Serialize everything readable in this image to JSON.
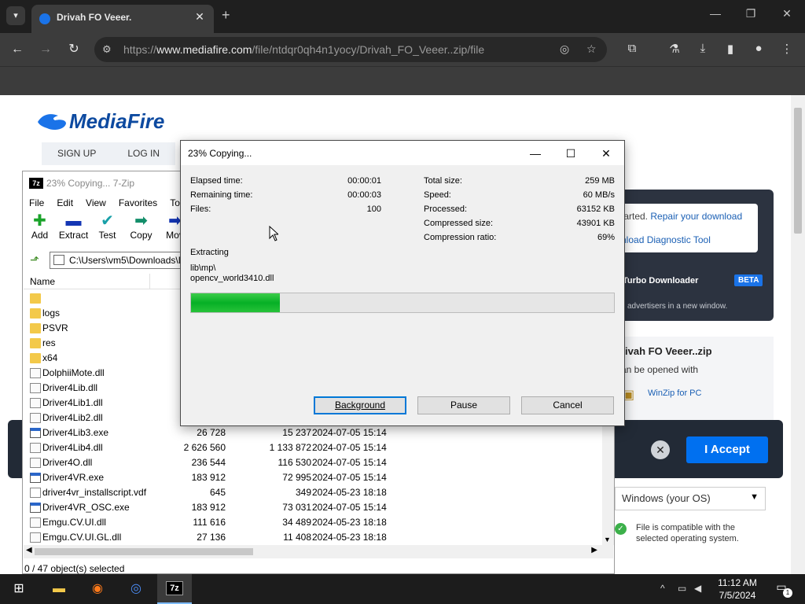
{
  "browser": {
    "tab_title": "Drivah FO Veeer.",
    "url_prefix": "https://",
    "url_host": "www.mediafire.com",
    "url_path": "/file/ntdqr0qh4n1yocy/Drivah_FO_Veeer..zip/file",
    "new_tab_label": "+"
  },
  "mediafire": {
    "logo_text": "MediaFire",
    "nav": [
      "SIGN UP",
      "LOG IN"
    ],
    "panel_line1_prefix": "tarted.",
    "panel_link1": "Repair your download",
    "panel_link2": "nload Diagnostic Tool",
    "turbo_label": "Turbo Downloader",
    "beta_label": "BETA",
    "advertisers_text": "advertisers in a new window.",
    "file_title": "rivah FO Veeer..zip",
    "opened_with": "an be opened with",
    "winzip_link": "WinZip for PC",
    "accept_label": "I Accept",
    "os_select": "Windows (your OS)",
    "compat_line1": "File is compatible with the",
    "compat_line2": "selected operating system."
  },
  "sevenzip": {
    "title": "23% Copying... 7-Zip",
    "menu": [
      "File",
      "Edit",
      "View",
      "Favorites",
      "Tools"
    ],
    "tools": [
      {
        "label": "Add",
        "icon": "plus-icon",
        "color": "#1aa32a"
      },
      {
        "label": "Extract",
        "icon": "minus-icon",
        "color": "#1436b4"
      },
      {
        "label": "Test",
        "icon": "check-icon",
        "color": "#18a0a8"
      },
      {
        "label": "Copy",
        "icon": "copy-arrow-icon",
        "color": "#138e6a"
      },
      {
        "label": "Mov",
        "icon": "move-arrow-icon",
        "color": "#1436b4"
      }
    ],
    "path": "C:\\Users\\vm5\\Downloads\\D",
    "column_name": "Name",
    "files": [
      {
        "name": "",
        "size": "1",
        "packed": "",
        "modified": "",
        "type": "folder"
      },
      {
        "name": "logs",
        "size": "",
        "packed": "",
        "modified": "",
        "type": "folder"
      },
      {
        "name": "PSVR",
        "size": "",
        "packed": "",
        "modified": "",
        "type": "folder"
      },
      {
        "name": "res",
        "size": "",
        "packed": "",
        "modified": "",
        "type": "folder"
      },
      {
        "name": "x64",
        "size": "",
        "packed": "",
        "modified": "",
        "type": "folder"
      },
      {
        "name": "DolphiiMote.dll",
        "size": "",
        "packed": "",
        "modified": "",
        "type": "dll"
      },
      {
        "name": "Driver4Lib.dll",
        "size": "",
        "packed": "",
        "modified": "",
        "type": "dll"
      },
      {
        "name": "Driver4Lib1.dll",
        "size": "",
        "packed": "",
        "modified": "",
        "type": "dll"
      },
      {
        "name": "Driver4Lib2.dll",
        "size": "",
        "packed": "",
        "modified": "",
        "type": "dll"
      },
      {
        "name": "Driver4Lib3.exe",
        "size": "26 728",
        "packed": "15 237",
        "modified": "2024-07-05 15:14",
        "type": "exe"
      },
      {
        "name": "Driver4Lib4.dll",
        "size": "2 626 560",
        "packed": "1 133 872",
        "modified": "2024-07-05 15:14",
        "type": "dll"
      },
      {
        "name": "Driver4O.dll",
        "size": "236 544",
        "packed": "116 530",
        "modified": "2024-07-05 15:14",
        "type": "dll"
      },
      {
        "name": "Driver4VR.exe",
        "size": "183 912",
        "packed": "72 995",
        "modified": "2024-07-05 15:14",
        "type": "exe"
      },
      {
        "name": "driver4vr_installscript.vdf",
        "size": "645",
        "packed": "349",
        "modified": "2024-05-23 18:18",
        "type": "vdf"
      },
      {
        "name": "Driver4VR_OSC.exe",
        "size": "183 912",
        "packed": "73 031",
        "modified": "2024-07-05 15:14",
        "type": "exe"
      },
      {
        "name": "Emgu.CV.UI.dll",
        "size": "111 616",
        "packed": "34 489",
        "modified": "2024-05-23 18:18",
        "type": "dll"
      },
      {
        "name": "Emgu.CV.UI.GL.dll",
        "size": "27 136",
        "packed": "11 408",
        "modified": "2024-05-23 18:18",
        "type": "dll"
      }
    ],
    "status": "0 / 47 object(s) selected"
  },
  "dialog": {
    "title": "23% Copying...",
    "elapsed_label": "Elapsed time:",
    "elapsed": "00:00:01",
    "remaining_label": "Remaining time:",
    "remaining": "00:00:03",
    "files_label": "Files:",
    "files": "100",
    "total_label": "Total size:",
    "total": "259 MB",
    "speed_label": "Speed:",
    "speed": "60 MB/s",
    "processed_label": "Processed:",
    "processed": "63152 KB",
    "compressed_label": "Compressed size:",
    "compressed": "43901 KB",
    "ratio_label": "Compression ratio:",
    "ratio": "69%",
    "extracting_label": "Extracting",
    "current_dir": "lib\\mp\\",
    "current_file": "opencv_world3410.dll",
    "progress_fraction": 0.21,
    "buttons": {
      "background": "Background",
      "pause": "Pause",
      "cancel": "Cancel"
    }
  },
  "taskbar": {
    "time": "11:12 AM",
    "date": "7/5/2024",
    "notif_count": "1",
    "zip_label": "7z"
  }
}
